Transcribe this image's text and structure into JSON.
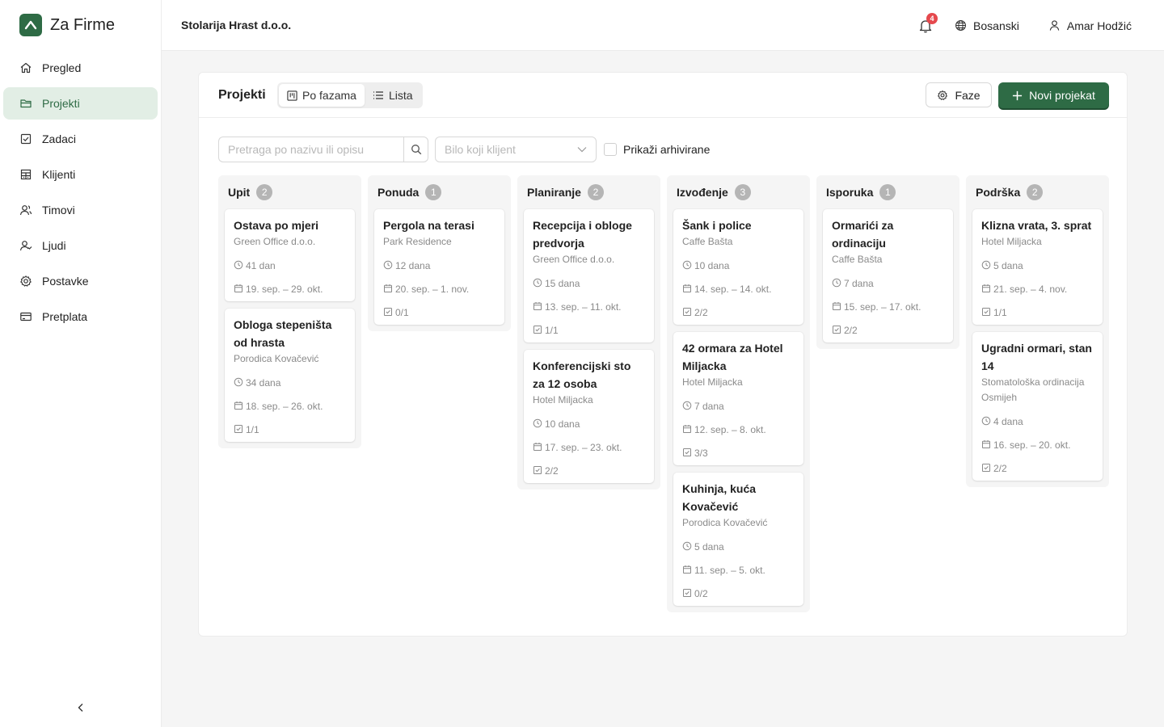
{
  "app": {
    "name": "Za Firme"
  },
  "sidebar": {
    "items": [
      {
        "label": "Pregled",
        "icon": "home-icon",
        "active": false
      },
      {
        "label": "Projekti",
        "icon": "folder-icon",
        "active": true
      },
      {
        "label": "Zadaci",
        "icon": "checkbox-icon",
        "active": false
      },
      {
        "label": "Klijenti",
        "icon": "building-icon",
        "active": false
      },
      {
        "label": "Timovi",
        "icon": "team-icon",
        "active": false
      },
      {
        "label": "Ljudi",
        "icon": "people-icon",
        "active": false
      },
      {
        "label": "Postavke",
        "icon": "gear-icon",
        "active": false
      },
      {
        "label": "Pretplata",
        "icon": "card-icon",
        "active": false
      }
    ]
  },
  "topbar": {
    "company": "Stolarija Hrast d.o.o.",
    "notifications": "4",
    "language": "Bosanski",
    "user": "Amar Hodžić"
  },
  "projects": {
    "title": "Projekti",
    "view_phases": "Po fazama",
    "view_list": "Lista",
    "phases_button": "Faze",
    "new_button": "Novi projekat",
    "search_placeholder": "Pretraga po nazivu ili opisu",
    "client_placeholder": "Bilo koji klijent",
    "show_archived": "Prikaži arhivirane"
  },
  "colors": {
    "accent": "#2e6b45",
    "accent_light": "#e2eee5",
    "badge": "#e5484d"
  },
  "board": {
    "columns": [
      {
        "title": "Upit",
        "count": "2",
        "cards": [
          {
            "title": "Ostava po mjeri",
            "client": "Green Office d.o.o.",
            "duration": "41 dan",
            "dates": "19. sep. – 29. okt.",
            "tasks": ""
          },
          {
            "title": "Obloga stepeništa od hrasta",
            "client": "Porodica Kovačević",
            "duration": "34 dana",
            "dates": "18. sep. – 26. okt.",
            "tasks": "1/1"
          }
        ]
      },
      {
        "title": "Ponuda",
        "count": "1",
        "cards": [
          {
            "title": "Pergola na terasi",
            "client": "Park Residence",
            "duration": "12 dana",
            "dates": "20. sep. – 1. nov.",
            "tasks": "0/1"
          }
        ]
      },
      {
        "title": "Planiranje",
        "count": "2",
        "cards": [
          {
            "title": "Recepcija i obloge predvorja",
            "client": "Green Office d.o.o.",
            "duration": "15 dana",
            "dates": "13. sep. – 11. okt.",
            "tasks": "1/1"
          },
          {
            "title": "Konferencijski sto za 12 osoba",
            "client": "Hotel Miljacka",
            "duration": "10 dana",
            "dates": "17. sep. – 23. okt.",
            "tasks": "2/2"
          }
        ]
      },
      {
        "title": "Izvođenje",
        "count": "3",
        "cards": [
          {
            "title": "Šank i police",
            "client": "Caffe Bašta",
            "duration": "10 dana",
            "dates": "14. sep. – 14. okt.",
            "tasks": "2/2"
          },
          {
            "title": "42 ormara za Hotel Miljacka",
            "client": "Hotel Miljacka",
            "duration": "7 dana",
            "dates": "12. sep. – 8. okt.",
            "tasks": "3/3"
          },
          {
            "title": "Kuhinja, kuća Kovačević",
            "client": "Porodica Kovačević",
            "duration": "5 dana",
            "dates": "11. sep. – 5. okt.",
            "tasks": "0/2"
          }
        ]
      },
      {
        "title": "Isporuka",
        "count": "1",
        "cards": [
          {
            "title": "Ormarići za ordinaciju",
            "client": "Caffe Bašta",
            "duration": "7 dana",
            "dates": "15. sep. – 17. okt.",
            "tasks": "2/2"
          }
        ]
      },
      {
        "title": "Podrška",
        "count": "2",
        "cards": [
          {
            "title": "Klizna vrata, 3. sprat",
            "client": "Hotel Miljacka",
            "duration": "5 dana",
            "dates": "21. sep. – 4. nov.",
            "tasks": "1/1"
          },
          {
            "title": "Ugradni ormari, stan 14",
            "client": "Stomatološka ordinacija Osmijeh",
            "duration": "4 dana",
            "dates": "16. sep. – 20. okt.",
            "tasks": "2/2"
          }
        ]
      }
    ]
  }
}
